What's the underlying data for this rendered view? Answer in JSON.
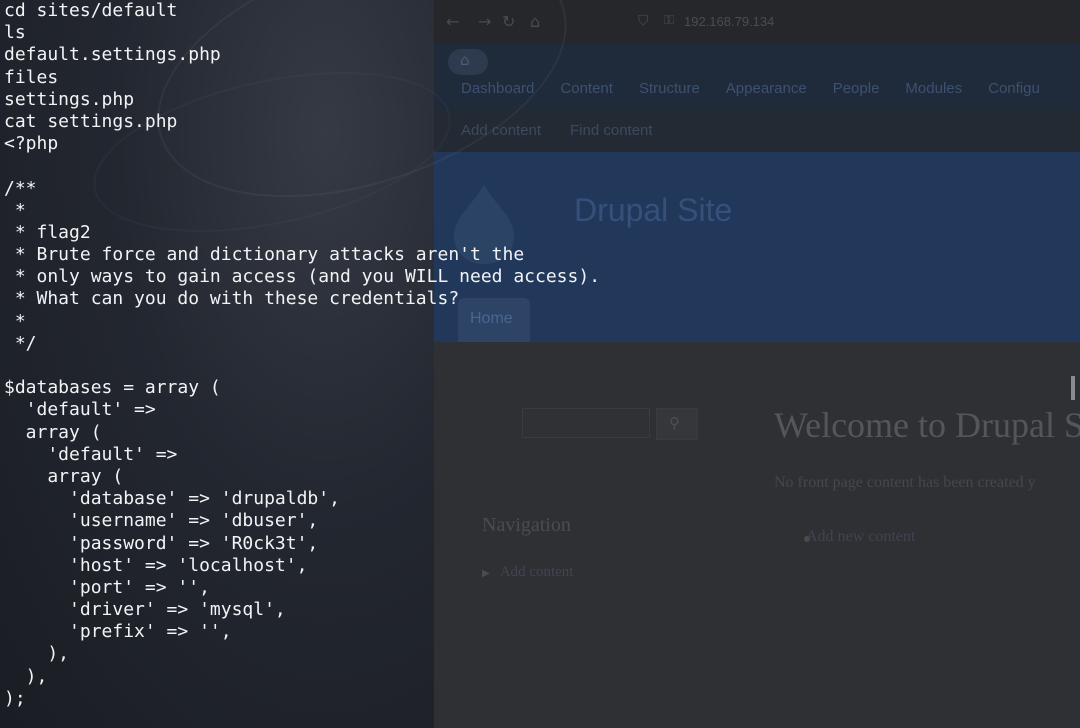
{
  "browser": {
    "url": "192.168.79.134",
    "menu": [
      "Dashboard",
      "Content",
      "Structure",
      "Appearance",
      "People",
      "Modules",
      "Configu"
    ],
    "shortcuts": [
      "Add content",
      "Find content"
    ],
    "site_name": "Drupal Site",
    "home_tab": "Home",
    "welcome_title": "Welcome to Drupal S",
    "no_content_text": "No front page content has been created y",
    "add_new_content": "Add new content",
    "nav_heading": "Navigation",
    "nav_link": "Add content",
    "icons": {
      "back": "arrow-left-icon",
      "forward": "arrow-right-icon",
      "reload": "reload-icon",
      "home": "home-icon",
      "shield": "shield-icon",
      "lock": "lock-icon",
      "search": "search-icon"
    }
  },
  "terminal": {
    "lines": [
      "cd sites/default",
      "ls",
      "default.settings.php",
      "files",
      "settings.php",
      "cat settings.php",
      "<?php",
      "",
      "/**",
      " *",
      " * flag2",
      " * Brute force and dictionary attacks aren't the",
      " * only ways to gain access (and you WILL need access).",
      " * What can you do with these credentials?",
      " *",
      " */",
      "",
      "$databases = array (",
      "  'default' =>",
      "  array (",
      "    'default' =>",
      "    array (",
      "      'database' => 'drupaldb',",
      "      'username' => 'dbuser',",
      "      'password' => 'R0ck3t',",
      "      'host' => 'localhost',",
      "      'port' => '',",
      "      'driver' => 'mysql',",
      "      'prefix' => '',",
      "    ),",
      "  ),",
      ");"
    ]
  }
}
